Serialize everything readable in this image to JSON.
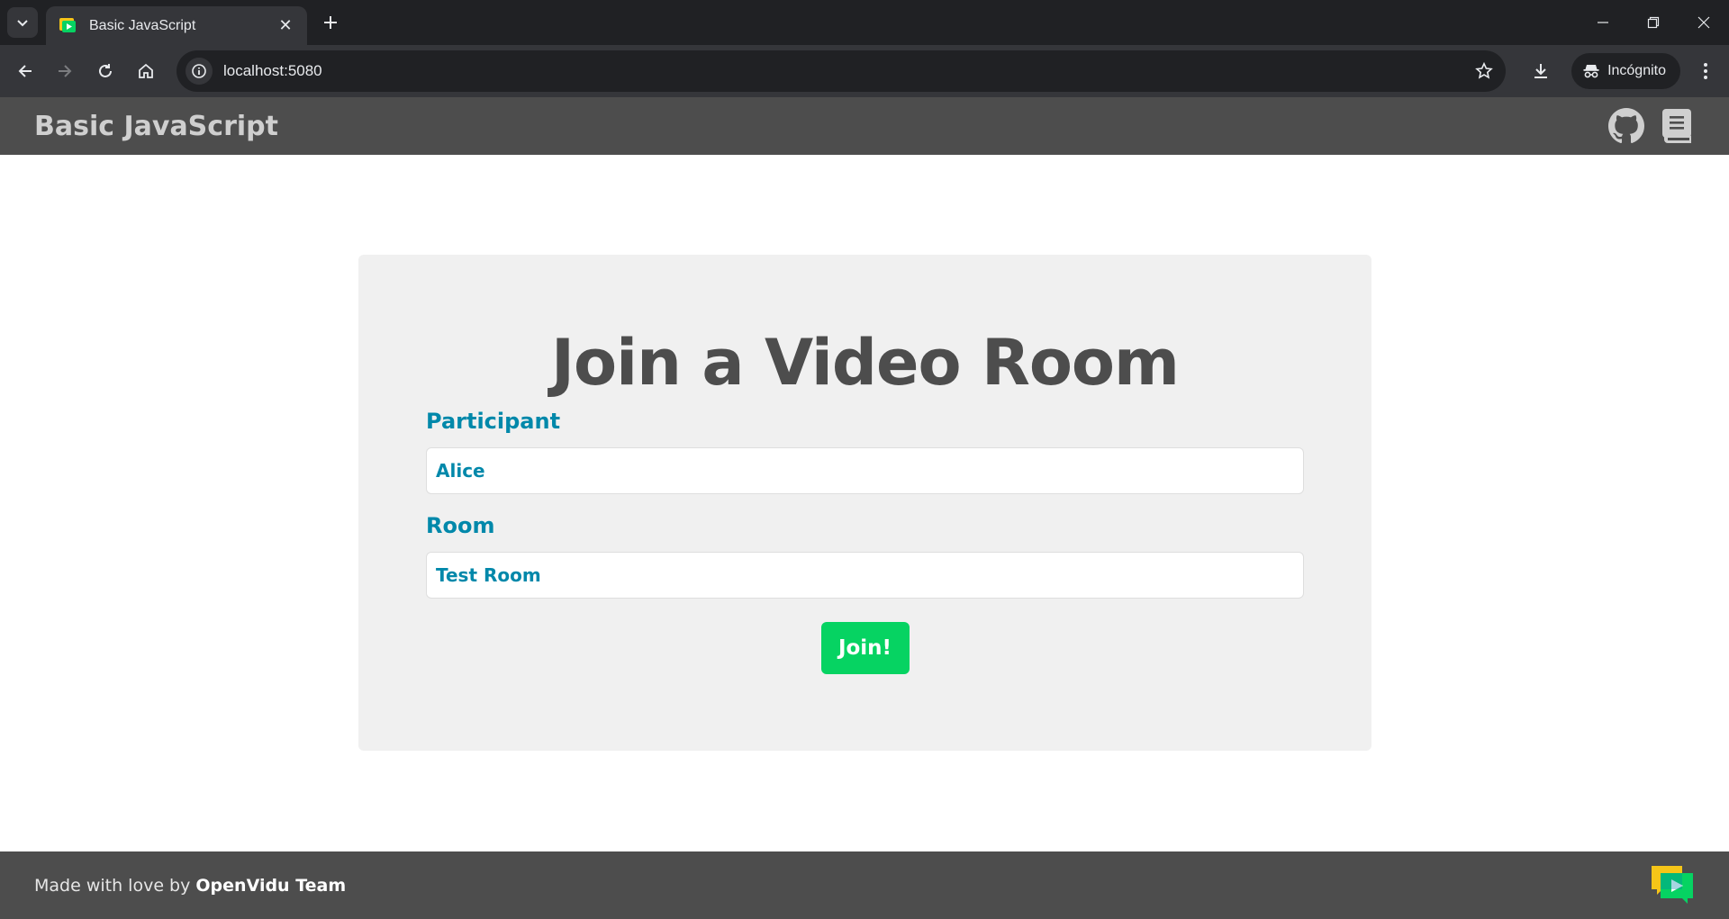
{
  "browser": {
    "tab": {
      "title": "Basic JavaScript",
      "close_glyph": "✕"
    },
    "address": {
      "url": "localhost:5080"
    },
    "incognito_label": "Incógnito",
    "icons": [
      "tab-search-icon",
      "favicon-icon",
      "close-icon",
      "plus-icon",
      "minimize-icon",
      "restore-icon",
      "window-close-icon",
      "back-icon",
      "forward-icon",
      "reload-icon",
      "home-icon",
      "site-info-icon",
      "star-icon",
      "download-icon",
      "incognito-icon",
      "more-vert-icon"
    ]
  },
  "header": {
    "title": "Basic JavaScript",
    "icons": [
      "github-icon",
      "book-icon"
    ]
  },
  "card": {
    "title": "Join a Video Room",
    "participant_label": "Participant",
    "participant_value": "Alice",
    "room_label": "Room",
    "room_value": "Test Room",
    "join_label": "Join!"
  },
  "footer": {
    "prefix": "Made with love by ",
    "team": "OpenVidu Team"
  },
  "colors": {
    "header_bg": "#4d4d4d",
    "accent": "#0088aa",
    "join_button": "#06d362",
    "card_bg": "#f0f0f0"
  }
}
